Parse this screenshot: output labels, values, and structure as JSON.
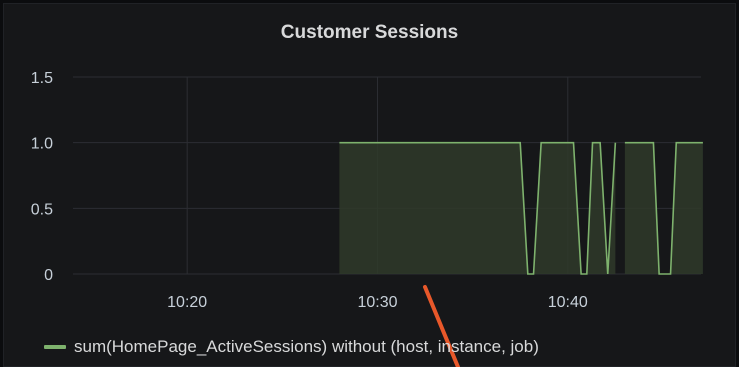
{
  "panel": {
    "title": "Customer Sessions"
  },
  "legend": {
    "label": "sum(HomePage_ActiveSessions) without (host, instance, job)"
  },
  "colors": {
    "background": "#161719",
    "grid": "#2c2e33",
    "series_line": "#7eb26d",
    "series_fill": "#2f3a2a",
    "annotation": "#e8582a"
  },
  "chart_data": {
    "type": "area",
    "title": "Customer Sessions",
    "xlabel": "",
    "ylabel": "",
    "ylim": [
      0,
      1.5
    ],
    "y_ticks": [
      "0",
      "0.5",
      "1.0",
      "1.5"
    ],
    "xlim": [
      "10:14",
      "10:47"
    ],
    "x_ticks": [
      "10:20",
      "10:30",
      "10:40"
    ],
    "grid": true,
    "legend_position": "bottom-left",
    "series": [
      {
        "name": "sum(HomePage_ActiveSessions) without (host, instance, job)",
        "segments": [
          {
            "x": [
              "10:28",
              "10:37.5",
              "10:37.9",
              "10:38.2",
              "10:38.6",
              "10:40.3",
              "10:40.7",
              "10:41",
              "10:41.3",
              "10:41.7",
              "10:42.1",
              "10:42.5"
            ],
            "y": [
              1,
              1,
              0,
              0,
              1,
              1,
              0,
              0,
              1,
              1,
              0,
              1
            ]
          },
          {
            "x": [
              "10:43",
              "10:44.5",
              "10:44.8",
              "10:45.4",
              "10:45.7",
              "10:47.1"
            ],
            "y": [
              1,
              1,
              0,
              0,
              1,
              1
            ]
          }
        ]
      }
    ]
  }
}
